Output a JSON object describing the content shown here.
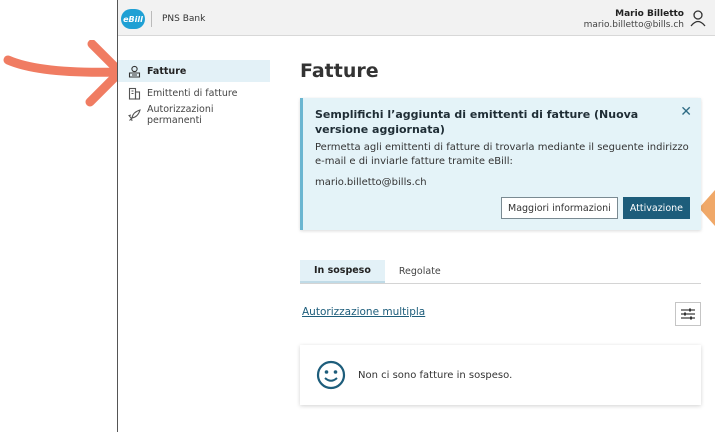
{
  "header": {
    "logo_text": "eBill",
    "bank_name": "PNS Bank",
    "user_name": "Mario Billetto",
    "user_email": "mario.billetto@bills.ch"
  },
  "sidebar": {
    "items": [
      {
        "label": "Fatture",
        "icon": "bills-icon",
        "active": true
      },
      {
        "label": "Emittenti di fatture",
        "icon": "issuer-building-icon",
        "active": false
      },
      {
        "label": "Autorizzazioni permanenti",
        "icon": "rocket-icon",
        "active": false
      }
    ]
  },
  "main": {
    "title": "Fatture",
    "notice": {
      "title": "Semplifichi l’aggiunta di emittenti di fatture (Nuova versione aggiornata)",
      "text": "Permetta agli emittenti di fatture di trovarla mediante il seguente indirizzo e-mail e di inviarle fatture tramite eBill:",
      "email": "mario.billetto@bills.ch",
      "close": "✕",
      "more_info_label": "Maggiori informazioni",
      "activate_label": "Attivazione"
    },
    "tabs": [
      {
        "label": "In sospeso",
        "active": true
      },
      {
        "label": "Regolate",
        "active": false
      }
    ],
    "multi_auth_link": "Autorizzazione multipla",
    "empty_message": "Non ci sono fatture in sospeso."
  },
  "colors": {
    "accent": "#1d5d7b",
    "logo": "#1fa0d4",
    "notice_bg": "#e4f3f8",
    "annotation_arrow": "#f07c62",
    "annotation_triangle": "#f0a868"
  }
}
